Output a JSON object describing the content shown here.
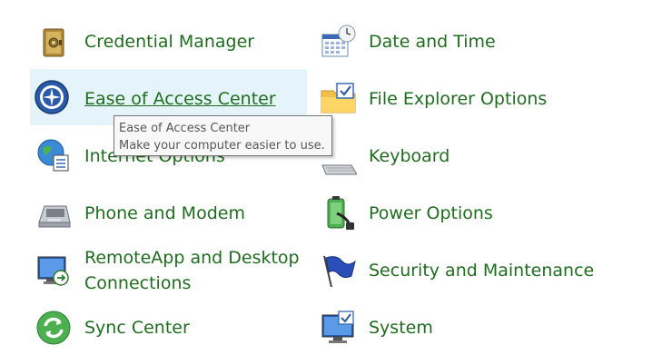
{
  "left_column": [
    {
      "name": "Credential Manager",
      "icon": "credential-manager-icon"
    },
    {
      "name": "Ease of Access Center",
      "icon": "ease-of-access-icon"
    },
    {
      "name": "Internet Options",
      "icon": "internet-options-icon"
    },
    {
      "name": "Phone and Modem",
      "icon": "phone-modem-icon"
    },
    {
      "name": "RemoteApp and Desktop",
      "name_line2": "Connections",
      "icon": "remoteapp-icon"
    },
    {
      "name": "Sync Center",
      "icon": "sync-center-icon"
    }
  ],
  "right_column": [
    {
      "name": "Date and Time",
      "icon": "date-time-icon"
    },
    {
      "name": "File Explorer Options",
      "icon": "file-explorer-options-icon"
    },
    {
      "name": "Keyboard",
      "icon": "keyboard-icon"
    },
    {
      "name": "Power Options",
      "icon": "power-options-icon"
    },
    {
      "name": "Security and Maintenance",
      "icon": "security-maintenance-icon"
    },
    {
      "name": "System",
      "icon": "system-icon"
    }
  ],
  "tooltip": {
    "title": "Ease of Access Center",
    "description": "Make your computer easier to use."
  },
  "colors": {
    "link": "#1e6e1e",
    "hover_bg": "#e5f3fb"
  }
}
